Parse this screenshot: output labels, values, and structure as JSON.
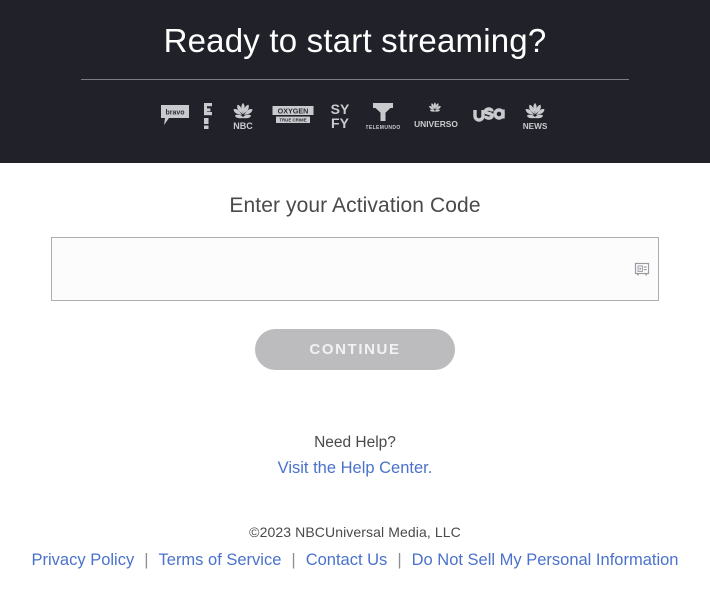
{
  "header": {
    "title": "Ready to start streaming?",
    "background_color": "#212229",
    "divider_color": "#7b7d85",
    "logos": [
      {
        "name": "bravo",
        "label": "bravo"
      },
      {
        "name": "e-entertainment",
        "label": "E!"
      },
      {
        "name": "nbc",
        "label": "NBC"
      },
      {
        "name": "oxygen-true-crime",
        "label": "OXYGEN TRUE CRIME"
      },
      {
        "name": "syfy",
        "label": "SYFY"
      },
      {
        "name": "telemundo",
        "label": "TELEMUNDO"
      },
      {
        "name": "universo",
        "label": "UNIVERSO"
      },
      {
        "name": "usa",
        "label": "USA"
      },
      {
        "name": "nbc-news",
        "label": "NBC NEWS"
      }
    ]
  },
  "main": {
    "activation_label": "Enter your Activation Code",
    "input": {
      "value": "",
      "placeholder": "",
      "icon": "vault-icon"
    },
    "continue_label": "CONTINUE",
    "continue_disabled": true,
    "continue_color": "#bcbcbe"
  },
  "help": {
    "title": "Need Help?",
    "link_label": "Visit the Help Center.",
    "link_color": "#4a72cc"
  },
  "footer": {
    "copyright": "©2023 NBCUniversal Media, LLC",
    "separator": "|",
    "links": [
      {
        "label": "Privacy Policy"
      },
      {
        "label": "Terms of Service"
      },
      {
        "label": "Contact Us"
      },
      {
        "label": "Do Not Sell My Personal Information"
      }
    ]
  }
}
